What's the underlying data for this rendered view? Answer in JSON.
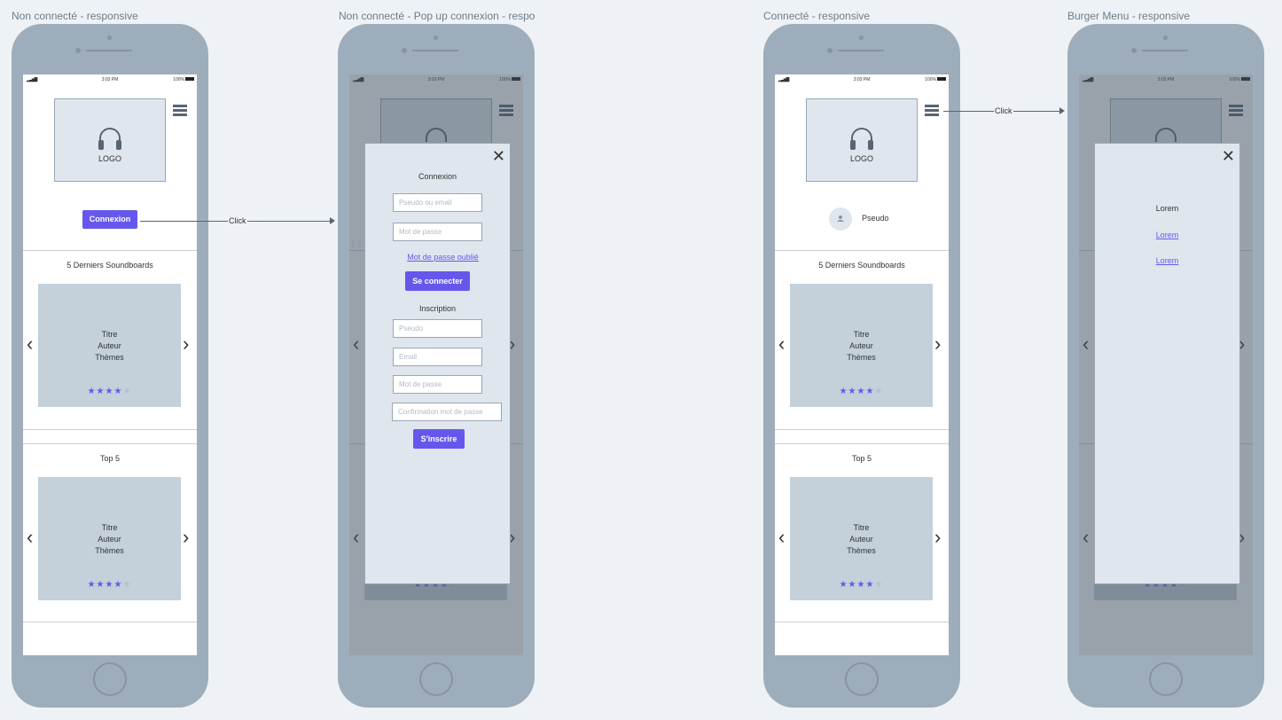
{
  "artboards": [
    {
      "label": "Non connecté - responsive"
    },
    {
      "label": "Non connecté - Pop up connexion - responsive"
    },
    {
      "label": "Connecté - responsive"
    },
    {
      "label": "Burger Menu - responsive"
    }
  ],
  "status_bar": {
    "signal": "▂▃▅▇",
    "time": "3:03 PM",
    "battery": "100%"
  },
  "logo": {
    "text": "LOGO",
    "icon": "headphones-icon"
  },
  "menu_icon": "burger-menu-icon",
  "header": {
    "connexion_button": "Connexion",
    "pseudo": "Pseudo"
  },
  "sections": [
    {
      "title": "5 Derniers Soundboards",
      "card": {
        "title": "Titre",
        "author": "Auteur",
        "themes": "Thèmes",
        "rating": 4,
        "max_rating": 5
      }
    },
    {
      "title": "Top 5",
      "card": {
        "title": "Titre",
        "author": "Auteur",
        "themes": "Thèmes",
        "rating": 4,
        "max_rating": 5
      }
    }
  ],
  "login_popup": {
    "title": "Connexion",
    "login_placeholder": "Pseudo ou email",
    "password_placeholder": "Mot de passe",
    "forgot_link": "Mot de passe oublié",
    "submit_label": "Se connecter",
    "register_title": "Inscription",
    "reg_pseudo_placeholder": "Pseudo",
    "reg_email_placeholder": "Email",
    "reg_password_placeholder": "Mot de passe",
    "reg_confirm_placeholder": "Confirmation mot de passe",
    "register_label": "S'inscrire"
  },
  "burger_menu": {
    "items": [
      "Lorem",
      "Lorem",
      "Lorem"
    ]
  },
  "connectors": [
    {
      "label": "Click"
    },
    {
      "label": "Click"
    }
  ],
  "colors": {
    "accent": "#6657ec",
    "background": "#eef2f6",
    "device": "#9eadbb",
    "placeholder": "#c4d0da"
  }
}
